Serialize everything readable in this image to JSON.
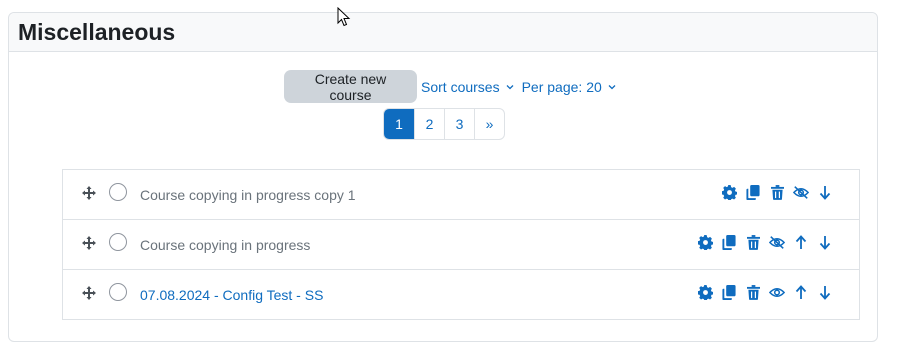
{
  "category": {
    "title": "Miscellaneous"
  },
  "toolbar": {
    "create_label": "Create new course",
    "sort_label": "Sort courses",
    "perpage_label": "Per page: 20"
  },
  "pagination": {
    "pages": [
      "1",
      "2",
      "3"
    ],
    "next": "»",
    "active": "1"
  },
  "courses": [
    {
      "name": "Course copying in progress copy 1",
      "actions": [
        "gear-icon",
        "copy-icon",
        "trash-icon",
        "eye-slash-icon",
        "arrow-down-icon"
      ]
    },
    {
      "name": "Course copying in progress",
      "actions": [
        "gear-icon",
        "copy-icon",
        "trash-icon",
        "eye-slash-icon",
        "arrow-up-icon",
        "arrow-down-icon"
      ]
    },
    {
      "name": "07.08.2024 - Config Test - SS",
      "actions": [
        "gear-icon",
        "copy-icon",
        "trash-icon",
        "eye-icon",
        "arrow-up-icon",
        "arrow-down-icon"
      ]
    }
  ],
  "colors": {
    "accent": "#0f6cbf",
    "muted_text": "#6a737b",
    "button_bg": "#ced4da"
  }
}
